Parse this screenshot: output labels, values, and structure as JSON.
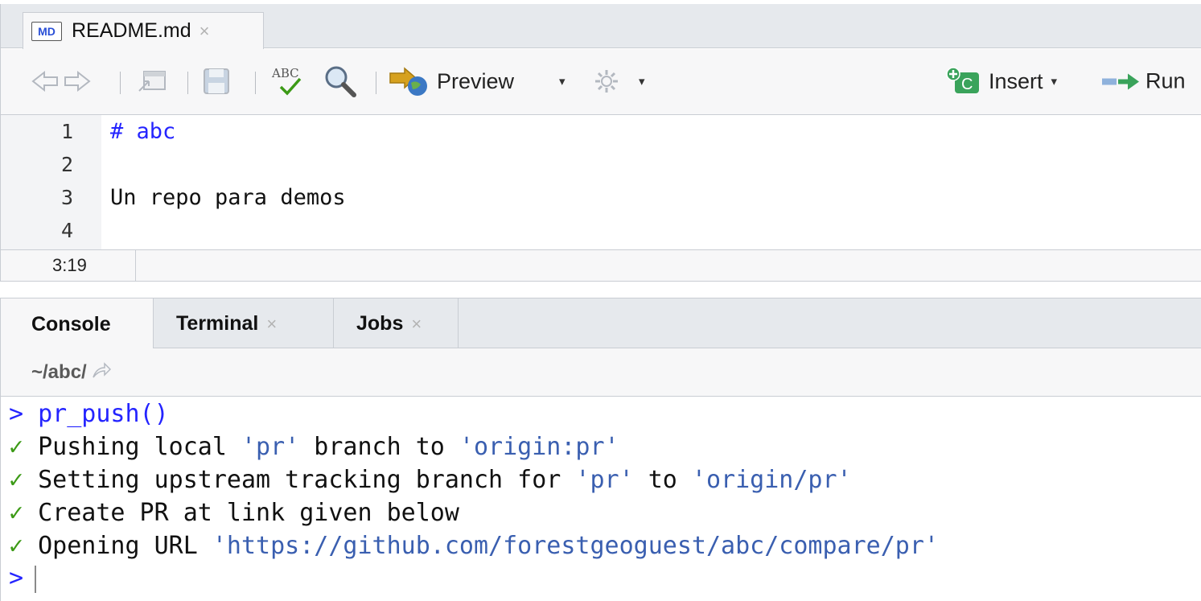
{
  "editor": {
    "tab": {
      "icon_text": "MD",
      "filename": "README.md",
      "close": "×"
    },
    "toolbar": {
      "preview_label": "Preview",
      "insert_label": "Insert",
      "run_label": "Run",
      "spell_icon_text": "ABC",
      "caret": "▾"
    },
    "lines": [
      {
        "num": "1",
        "text": "# abc",
        "style": "heading"
      },
      {
        "num": "2",
        "text": ""
      },
      {
        "num": "3",
        "text": "Un repo para demos"
      },
      {
        "num": "4",
        "text": ""
      }
    ],
    "cursor_position": "3:19"
  },
  "console": {
    "tabs": [
      {
        "label": "Console",
        "closable": false
      },
      {
        "label": "Terminal",
        "closable": true
      },
      {
        "label": "Jobs",
        "closable": true
      }
    ],
    "close": "×",
    "path": "~/abc/",
    "prompt": ">",
    "command": "pr_push()",
    "check_mark": "✓",
    "output": [
      {
        "before": "Pushing local ",
        "s1": "'pr'",
        "mid": " branch to ",
        "s2": "'origin:pr'"
      },
      {
        "before": "Setting upstream tracking branch for ",
        "s1": "'pr'",
        "mid": " to ",
        "s2": "'origin/pr'"
      },
      {
        "before": "Create PR at link given below",
        "s1": "",
        "mid": "",
        "s2": ""
      },
      {
        "before": "Opening URL ",
        "s1": "'https://github.com/forestgeoguest/abc/compare/pr'",
        "mid": "",
        "s2": ""
      }
    ]
  },
  "colors": {
    "accent_blue": "#2424ff",
    "check_green": "#3c9a16",
    "string_blue": "#3a5fb0"
  }
}
